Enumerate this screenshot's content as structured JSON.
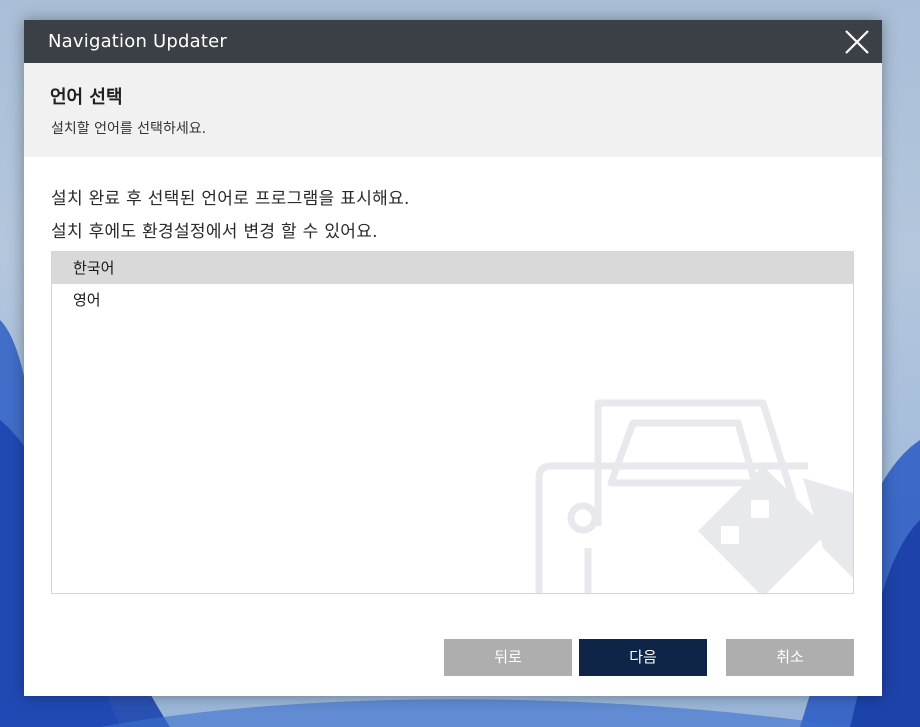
{
  "window": {
    "title": "Navigation Updater"
  },
  "header": {
    "title": "언어 선택",
    "subtitle": "설치할 언어를 선택하세요."
  },
  "content": {
    "line1": "설치 완료 후 선택된 언어로 프로그램을 표시해요.",
    "line2": "설치 후에도 환경설정에서 변경 할 수 있어요."
  },
  "languages": {
    "selected": "한국어",
    "items": [
      {
        "label": "한국어"
      },
      {
        "label": "영어"
      }
    ]
  },
  "buttons": {
    "back": "뒤로",
    "next": "다음",
    "cancel": "취소"
  },
  "colors": {
    "titlebar": "#3b3f46",
    "header_bg": "#f1f1f1",
    "primary_button": "#0f2547",
    "secondary_button": "#aeaeae",
    "selected_row": "#d9d9d9"
  },
  "icons": {
    "close": "close-icon",
    "watermark": "car-icon"
  }
}
